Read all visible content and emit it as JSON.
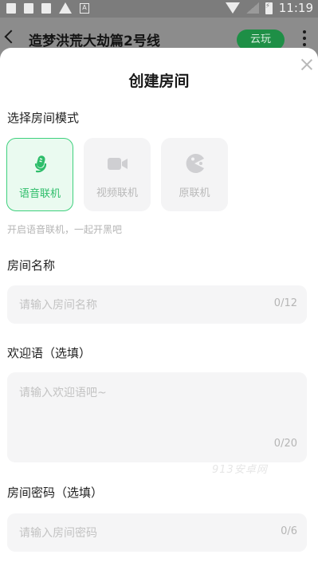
{
  "status_bar": {
    "time": "11:19",
    "notif_a": "A"
  },
  "header": {
    "title": "造梦洪荒大劫篇2号线",
    "cloud_play": "云玩"
  },
  "sheet": {
    "title": "创建房间",
    "mode_section": {
      "label": "选择房间模式",
      "modes": [
        {
          "label": "语音联机",
          "icon": "microphone-icon",
          "active": true
        },
        {
          "label": "视频联机",
          "icon": "video-camera-icon",
          "active": false
        },
        {
          "label": "原联机",
          "icon": "pacman-icon",
          "active": false
        }
      ],
      "hint": "开启语音联机，一起开黑吧"
    },
    "room_name": {
      "label": "房间名称",
      "placeholder": "请输入房间名称",
      "counter": "0/12"
    },
    "welcome": {
      "label": "欢迎语（选填）",
      "placeholder": "请输入欢迎语吧~",
      "counter": "0/20"
    },
    "password": {
      "label": "房间密码（选填）",
      "placeholder": "请输入房间密码",
      "counter": "0/6"
    }
  },
  "watermark": "913安卓网",
  "colors": {
    "accent": "#3ed07d",
    "accent_text": "#2ebd6a",
    "cloud_button": "#1e8f46"
  }
}
